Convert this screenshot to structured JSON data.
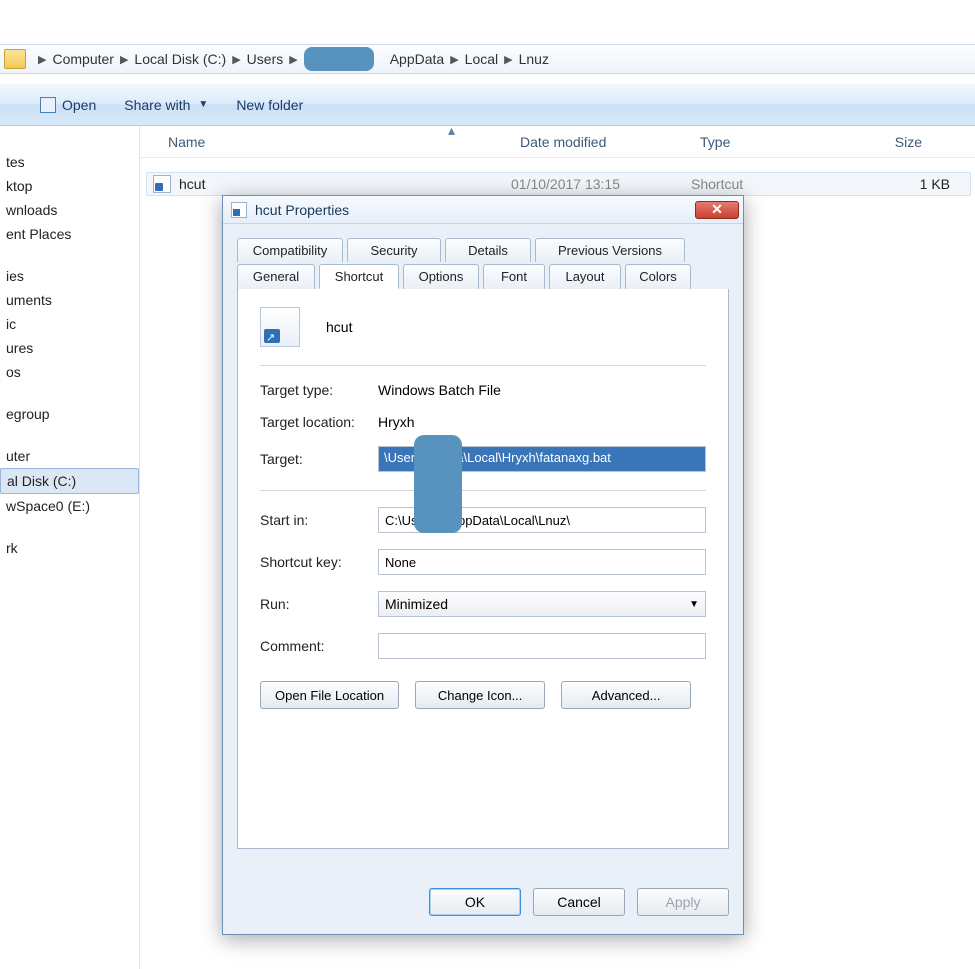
{
  "breadcrumb": {
    "items": [
      "Computer",
      "Local Disk (C:)",
      "Users",
      "",
      "AppData",
      "Local",
      "Lnuz"
    ]
  },
  "toolbar": {
    "open": "Open",
    "share": "Share with",
    "newfolder": "New folder"
  },
  "sidebar": {
    "items": [
      "tes",
      "ktop",
      "wnloads",
      "ent Places",
      "",
      "ies",
      "uments",
      "ic",
      "ures",
      "os",
      "",
      "egroup",
      "",
      "uter",
      "al Disk (C:)",
      "wSpace0 (E:)",
      "",
      "rk"
    ],
    "selected_index": 14
  },
  "columns": {
    "name": "Name",
    "date": "Date modified",
    "type": "Type",
    "size": "Size"
  },
  "file": {
    "name": "hcut",
    "date": "01/10/2017 13:15",
    "type": "Shortcut",
    "size": "1 KB"
  },
  "dialog": {
    "title": "hcut Properties",
    "tabs_row1": [
      "Compatibility",
      "Security",
      "Details",
      "Previous Versions"
    ],
    "tabs_row2": [
      "General",
      "Shortcut",
      "Options",
      "Font",
      "Layout",
      "Colors"
    ],
    "icon_name": "hcut",
    "target_type_lbl": "Target type:",
    "target_type_val": "Windows Batch File",
    "target_loc_lbl": "Target location:",
    "target_loc_val": "Hryxh",
    "target_lbl": "Target:",
    "target_val": "\\Users\\        pData\\Local\\Hryxh\\fatanaxg.bat",
    "startin_lbl": "Start in:",
    "startin_val": "C:\\Use       AppData\\Local\\Lnuz\\",
    "shortcut_lbl": "Shortcut key:",
    "shortcut_val": "None",
    "run_lbl": "Run:",
    "run_val": "Minimized",
    "comment_lbl": "Comment:",
    "comment_val": "",
    "btn_openloc": "Open File Location",
    "btn_changeicon": "Change Icon...",
    "btn_advanced": "Advanced...",
    "btn_ok": "OK",
    "btn_cancel": "Cancel",
    "btn_apply": "Apply"
  }
}
